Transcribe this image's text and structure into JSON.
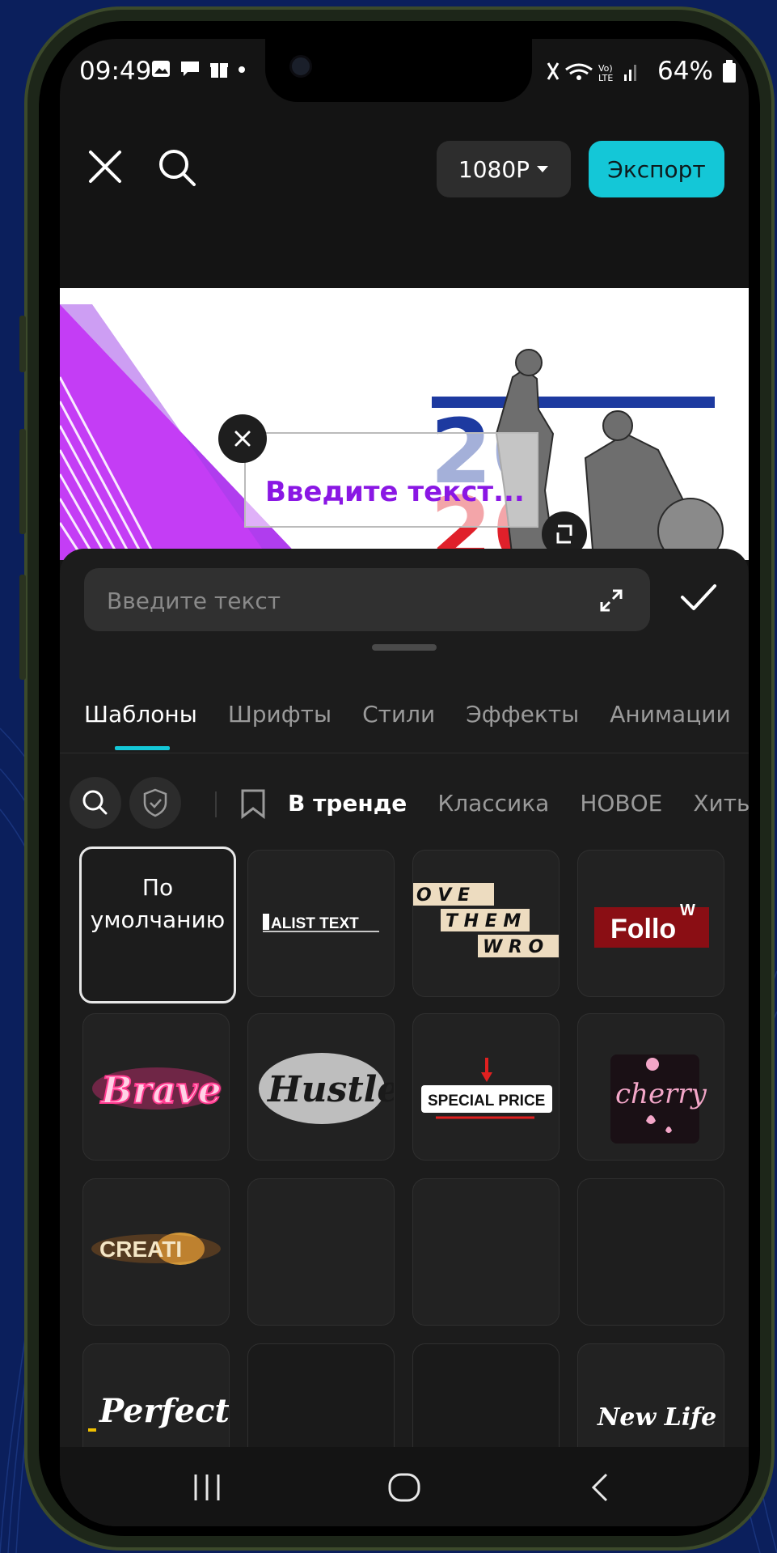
{
  "status_bar": {
    "time": "09:49",
    "battery": "64%"
  },
  "top_bar": {
    "resolution_label": "1080P",
    "export_label": "Экспорт"
  },
  "preview": {
    "placeholder_text": "Введите текст..."
  },
  "text_input": {
    "placeholder": "Введите текст"
  },
  "tabs": [
    "Шаблоны",
    "Шрифты",
    "Стили",
    "Эффекты",
    "Анимации"
  ],
  "active_tab": "Шаблоны",
  "filters": {
    "chips": [
      "В тренде",
      "Классика",
      "НОВОЕ",
      "Хиты"
    ],
    "active": "В тренде"
  },
  "templates": {
    "default_label": "По умолчанию",
    "items": [
      "ALIST TEXT",
      "OVE THEM WRO",
      "Follow",
      "Brave",
      "Hustle",
      "SPECIAL PRICE",
      "cherry",
      "CREATIVE",
      "Perfect!",
      "New Life"
    ]
  },
  "colors": {
    "accent": "#14c7d7",
    "background": "#141414",
    "sheet": "#1c1c1c"
  }
}
